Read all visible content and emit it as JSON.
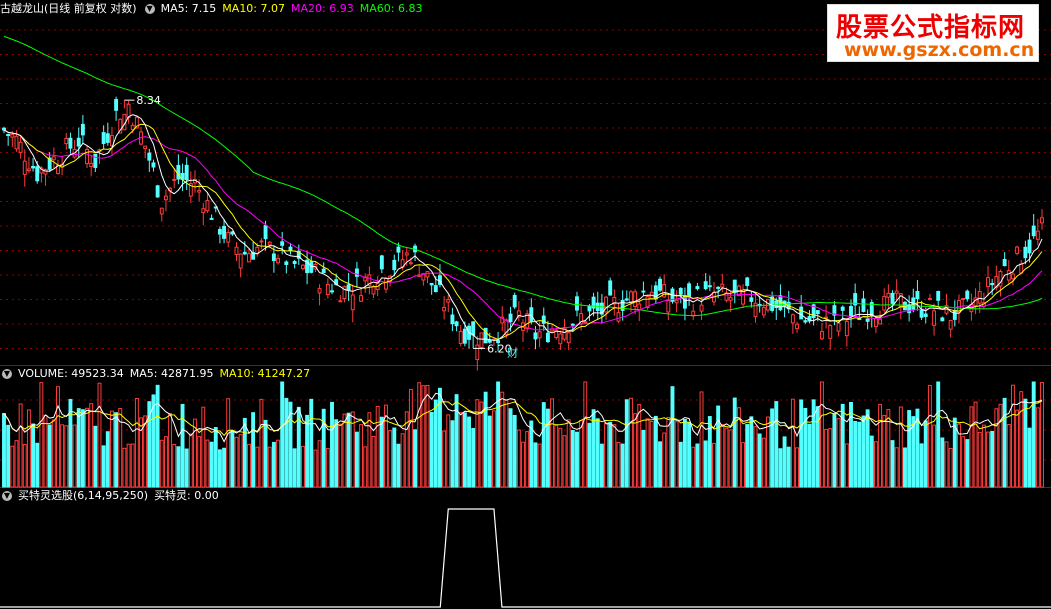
{
  "price_header": {
    "title": "古越龙山(日线 前复权 对数)",
    "ma5": "MA5: 7.15",
    "ma10": "MA10: 7.07",
    "ma20": "MA20: 6.93",
    "ma60": "MA60: 6.83"
  },
  "volume_header": {
    "label": "VOLUME: 49523.34",
    "ma5": "MA5: 42871.95",
    "ma10": "MA10: 41247.27"
  },
  "indicator_header": {
    "label": "买特灵选股(6,14,95,250)",
    "value": "买特灵: 0.00"
  },
  "annotations": {
    "high": "8.34",
    "low": "6.20",
    "event": "财"
  },
  "watermark": {
    "line1": "股票公式指标网",
    "line2": "www.gszx.com.cn"
  },
  "colors": {
    "up": "#ff3c3c",
    "down": "#54ffff",
    "ma5": "#ffffff",
    "ma10": "#ffff00",
    "ma20": "#ff00ff",
    "ma60": "#00ff00",
    "grid": "#8b0000",
    "indicator": "#ffffff"
  },
  "chart_data": [
    {
      "type": "candlestick",
      "title": "古越龙山(日线 前复权 对数)",
      "log_scale": true,
      "y_range": [
        6.1,
        9.2
      ],
      "marked_high": 8.34,
      "marked_low": 6.2,
      "ohlc_keypoints": [
        {
          "i": 0,
          "close": 8.05
        },
        {
          "i": 3,
          "close": 7.95
        },
        {
          "i": 8,
          "close": 7.65
        },
        {
          "i": 13,
          "close": 7.8
        },
        {
          "i": 18,
          "close": 7.95
        },
        {
          "i": 22,
          "close": 7.75
        },
        {
          "i": 27,
          "close": 8.2
        },
        {
          "i": 30,
          "close": 8.3
        },
        {
          "i": 34,
          "close": 7.9
        },
        {
          "i": 38,
          "close": 7.4
        },
        {
          "i": 42,
          "close": 7.6
        },
        {
          "i": 46,
          "close": 7.55
        },
        {
          "i": 50,
          "close": 7.3
        },
        {
          "i": 54,
          "close": 7.05
        },
        {
          "i": 58,
          "close": 6.95
        },
        {
          "i": 62,
          "close": 7.0
        },
        {
          "i": 66,
          "close": 6.95
        },
        {
          "i": 70,
          "close": 6.85
        },
        {
          "i": 74,
          "close": 6.8
        },
        {
          "i": 78,
          "close": 6.7
        },
        {
          "i": 82,
          "close": 6.65
        },
        {
          "i": 86,
          "close": 6.7
        },
        {
          "i": 90,
          "close": 6.8
        },
        {
          "i": 94,
          "close": 6.85
        },
        {
          "i": 98,
          "close": 6.95
        },
        {
          "i": 102,
          "close": 6.75
        },
        {
          "i": 105,
          "close": 6.6
        },
        {
          "i": 108,
          "close": 6.45
        },
        {
          "i": 110,
          "close": 6.35
        },
        {
          "i": 113,
          "close": 6.3
        },
        {
          "i": 116,
          "close": 6.28
        },
        {
          "i": 120,
          "close": 6.35
        },
        {
          "i": 124,
          "close": 6.45
        },
        {
          "i": 128,
          "close": 6.3
        },
        {
          "i": 132,
          "close": 6.35
        },
        {
          "i": 136,
          "close": 6.4
        },
        {
          "i": 140,
          "close": 6.45
        },
        {
          "i": 144,
          "close": 6.48
        },
        {
          "i": 148,
          "close": 6.55
        },
        {
          "i": 152,
          "close": 6.6
        },
        {
          "i": 156,
          "close": 6.65
        },
        {
          "i": 160,
          "close": 6.58
        },
        {
          "i": 164,
          "close": 6.55
        },
        {
          "i": 168,
          "close": 6.6
        },
        {
          "i": 172,
          "close": 6.62
        },
        {
          "i": 176,
          "close": 6.58
        },
        {
          "i": 180,
          "close": 6.6
        },
        {
          "i": 184,
          "close": 6.55
        },
        {
          "i": 188,
          "close": 6.48
        },
        {
          "i": 192,
          "close": 6.42
        },
        {
          "i": 196,
          "close": 6.4
        },
        {
          "i": 200,
          "close": 6.38
        },
        {
          "i": 204,
          "close": 6.45
        },
        {
          "i": 208,
          "close": 6.5
        },
        {
          "i": 212,
          "close": 6.52
        },
        {
          "i": 216,
          "close": 6.55
        },
        {
          "i": 220,
          "close": 6.52
        },
        {
          "i": 224,
          "close": 6.5
        },
        {
          "i": 228,
          "close": 6.45
        },
        {
          "i": 232,
          "close": 6.5
        },
        {
          "i": 236,
          "close": 6.62
        },
        {
          "i": 240,
          "close": 6.8
        },
        {
          "i": 244,
          "close": 6.9
        },
        {
          "i": 248,
          "close": 7.05
        },
        {
          "i": 250,
          "close": 7.15
        }
      ],
      "last_ma": {
        "MA5": 7.15,
        "MA10": 7.07,
        "MA20": 6.93,
        "MA60": 6.83
      }
    },
    {
      "type": "bar",
      "title": "VOLUME",
      "last": {
        "VOLUME": 49523.34,
        "MA5": 42871.95,
        "MA10": 41247.27
      }
    },
    {
      "type": "line",
      "title": "买特灵选股(6,14,95,250)",
      "y_range": [
        0,
        1
      ],
      "pulse_from_index": 107,
      "pulse_to_index": 118,
      "last_value": 0.0
    }
  ]
}
